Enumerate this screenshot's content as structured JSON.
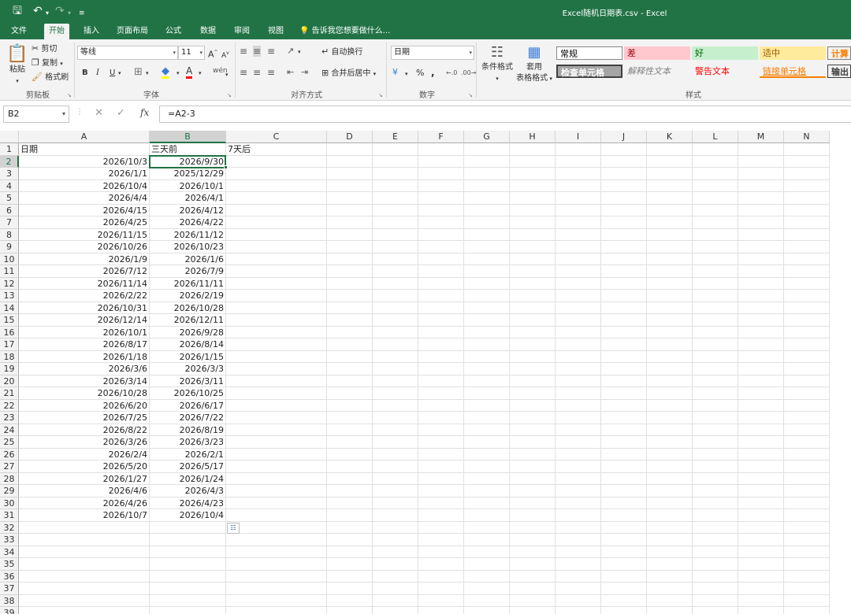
{
  "window": {
    "title": "Excel随机日期表.csv - Excel"
  },
  "tabs": [
    {
      "label": "文件",
      "active": false
    },
    {
      "label": "开始",
      "active": true
    },
    {
      "label": "插入",
      "active": false
    },
    {
      "label": "页面布局",
      "active": false
    },
    {
      "label": "公式",
      "active": false
    },
    {
      "label": "数据",
      "active": false
    },
    {
      "label": "审阅",
      "active": false
    },
    {
      "label": "视图",
      "active": false
    }
  ],
  "tell_me": "告诉我您想要做什么...",
  "ribbon": {
    "clipboard": {
      "paste": "粘贴",
      "cut": "剪切",
      "copy": "复制",
      "format_painter": "格式刷",
      "label": "剪贴板"
    },
    "font": {
      "name": "等线",
      "size": "11",
      "label": "字体",
      "bold": "B",
      "italic": "I",
      "underline": "U"
    },
    "alignment": {
      "wrap": "自动换行",
      "merge": "合并后居中",
      "label": "对齐方式"
    },
    "number": {
      "format": "日期",
      "percent": "%",
      "comma": ",",
      "label": "数字"
    },
    "styles": {
      "conditional": "条件格式",
      "table_line1": "套用",
      "table_line2": "表格格式",
      "label": "样式",
      "cells": [
        {
          "text": "常规",
          "bg": "#ffffff",
          "fg": "#000000"
        },
        {
          "text": "差",
          "bg": "#ffc7ce",
          "fg": "#9c0006"
        },
        {
          "text": "好",
          "bg": "#c6efce",
          "fg": "#006100"
        },
        {
          "text": "适中",
          "bg": "#ffeb9c",
          "fg": "#9c5700"
        },
        {
          "text": "计算",
          "bg": "#f2f2f2",
          "fg": "#fa7d00"
        },
        {
          "text": "检查单元格",
          "bg": "#a5a5a5",
          "fg": "#ffffff"
        },
        {
          "text": "解释性文本",
          "bg": "#f3f3f3",
          "fg": "#7f7f7f"
        },
        {
          "text": "警告文本",
          "bg": "#f3f3f3",
          "fg": "#ff0000"
        },
        {
          "text": "链接单元格",
          "bg": "#f3f3f3",
          "fg": "#fa7d00"
        },
        {
          "text": "输出",
          "bg": "#f2f2f2",
          "fg": "#3f3f3f"
        }
      ]
    }
  },
  "formula_bar": {
    "name_box": "B2",
    "formula": "=A2-3",
    "fx": "fx"
  },
  "sheet": {
    "columns": [
      "A",
      "B",
      "C",
      "D",
      "E",
      "F",
      "G",
      "H",
      "I",
      "J",
      "K",
      "L",
      "M",
      "N"
    ],
    "selected_column": "B",
    "selected_row": 2,
    "header_row": [
      "日期",
      "三天前",
      "7天后"
    ],
    "rows": [
      [
        "2026/10/3",
        "2026/9/30"
      ],
      [
        "2026/1/1",
        "2025/12/29"
      ],
      [
        "2026/10/4",
        "2026/10/1"
      ],
      [
        "2026/4/4",
        "2026/4/1"
      ],
      [
        "2026/4/15",
        "2026/4/12"
      ],
      [
        "2026/4/25",
        "2026/4/22"
      ],
      [
        "2026/11/15",
        "2026/11/12"
      ],
      [
        "2026/10/26",
        "2026/10/23"
      ],
      [
        "2026/1/9",
        "2026/1/6"
      ],
      [
        "2026/7/12",
        "2026/7/9"
      ],
      [
        "2026/11/14",
        "2026/11/11"
      ],
      [
        "2026/2/22",
        "2026/2/19"
      ],
      [
        "2026/10/31",
        "2026/10/28"
      ],
      [
        "2026/12/14",
        "2026/12/11"
      ],
      [
        "2026/10/1",
        "2026/9/28"
      ],
      [
        "2026/8/17",
        "2026/8/14"
      ],
      [
        "2026/1/18",
        "2026/1/15"
      ],
      [
        "2026/3/6",
        "2026/3/3"
      ],
      [
        "2026/3/14",
        "2026/3/11"
      ],
      [
        "2026/10/28",
        "2026/10/25"
      ],
      [
        "2026/6/20",
        "2026/6/17"
      ],
      [
        "2026/7/25",
        "2026/7/22"
      ],
      [
        "2026/8/22",
        "2026/8/19"
      ],
      [
        "2026/3/26",
        "2026/3/23"
      ],
      [
        "2026/2/4",
        "2026/2/1"
      ],
      [
        "2026/5/20",
        "2026/5/17"
      ],
      [
        "2026/1/27",
        "2026/1/24"
      ],
      [
        "2026/4/6",
        "2026/4/3"
      ],
      [
        "2026/4/26",
        "2026/4/23"
      ],
      [
        "2026/10/7",
        "2026/10/4"
      ]
    ],
    "row_count": 39
  }
}
